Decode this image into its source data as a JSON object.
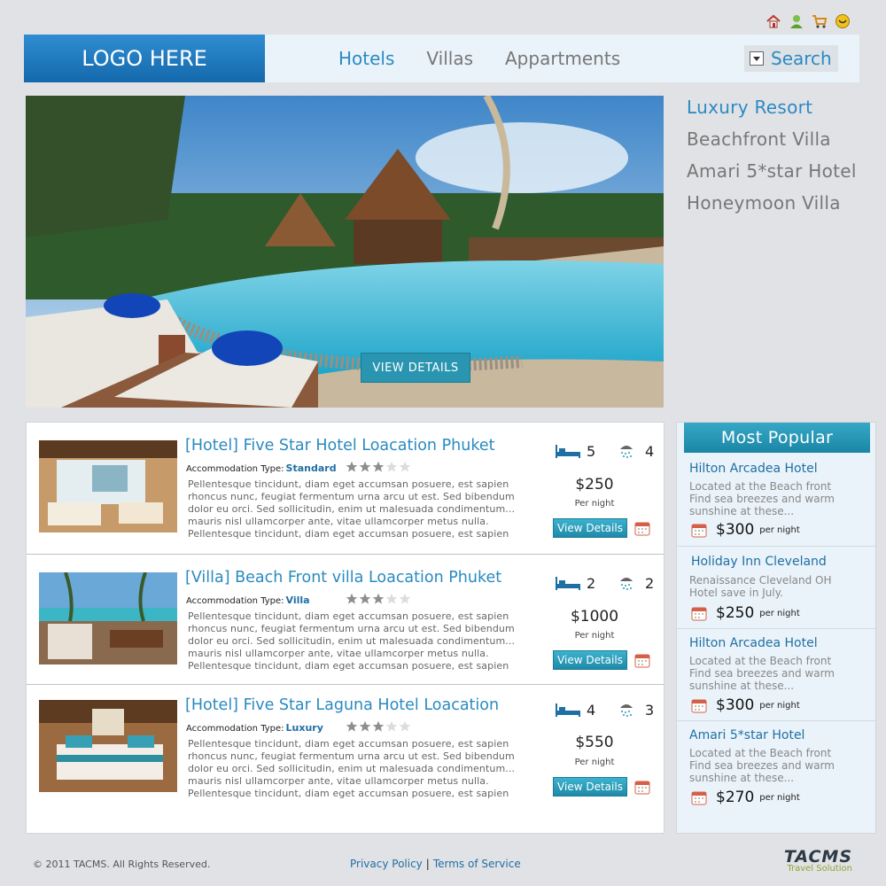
{
  "header": {
    "logo": "LOGO HERE",
    "nav": [
      {
        "label": "Hotels",
        "active": true
      },
      {
        "label": "Villas",
        "active": false
      },
      {
        "label": "Appartments",
        "active": false
      }
    ],
    "search_label": "Search"
  },
  "utility_icons": [
    "home-icon",
    "user-icon",
    "cart-icon",
    "help-icon"
  ],
  "hero": {
    "button_label": "VIEW DETAILS"
  },
  "side_nav": [
    {
      "label": "Luxury Resort",
      "active": true
    },
    {
      "label": "Beachfront Villa",
      "active": false
    },
    {
      "label": "Amari 5*star Hotel",
      "active": false
    },
    {
      "label": "Honeymoon Villa",
      "active": false
    }
  ],
  "listings": [
    {
      "title": "[Hotel] Five Star Hotel Loacation Phuket",
      "accommodation_label": "Accommodation Type:",
      "accommodation_type": "Standard",
      "rating": 3,
      "rating_max": 5,
      "description": [
        "Pellentesque tincidunt, diam eget accumsan posuere, est sapien",
        "rhoncus nunc, feugiat fermentum urna arcu ut est. Sed bibendum",
        "dolor eu orci. Sed sollicitudin, enim ut malesuada condimentum...",
        "mauris nisl ullamcorper ante, vitae ullamcorper metus nulla.",
        "Pellentesque tincidunt, diam eget accumsan posuere, est sapien"
      ],
      "beds": "5",
      "showers": "4",
      "price": "$250",
      "per_night": "Per night",
      "button_label": "View Details"
    },
    {
      "title": "[Villa] Beach Front villa Loacation Phuket",
      "accommodation_label": "Accommodation Type:",
      "accommodation_type": "Villa",
      "rating": 3,
      "rating_max": 5,
      "description": [
        "Pellentesque tincidunt, diam eget accumsan posuere, est sapien",
        "rhoncus nunc, feugiat fermentum urna arcu ut est. Sed bibendum",
        "dolor eu orci. Sed sollicitudin, enim ut malesuada condimentum...",
        "mauris nisl ullamcorper ante, vitae ullamcorper metus nulla.",
        "Pellentesque tincidunt, diam eget accumsan posuere, est sapien"
      ],
      "beds": "2",
      "showers": "2",
      "price": "$1000",
      "per_night": "Per night",
      "button_label": "View Details"
    },
    {
      "title": "[Hotel] Five Star Laguna Hotel Loacation",
      "accommodation_label": "Accommodation Type:",
      "accommodation_type": "Luxury",
      "rating": 3,
      "rating_max": 5,
      "description": [
        "Pellentesque tincidunt, diam eget accumsan posuere, est sapien",
        "rhoncus nunc, feugiat fermentum urna arcu ut est. Sed bibendum",
        "dolor eu orci. Sed sollicitudin, enim ut malesuada condimentum...",
        "mauris nisl ullamcorper ante, vitae ullamcorper metus nulla.",
        "Pellentesque tincidunt, diam eget accumsan posuere, est sapien"
      ],
      "beds": "4",
      "showers": "3",
      "price": "$550",
      "per_night": "Per night",
      "button_label": "View Details"
    }
  ],
  "popular": {
    "title": "Most Popular",
    "items": [
      {
        "name": "Hilton Arcadea Hotel",
        "description": [
          "Located at the Beach front",
          "Find sea breezes and warm",
          "sunshine at these..."
        ],
        "price": "$300",
        "per_night": "per night"
      },
      {
        "name": "Holiday Inn Cleveland",
        "description": [
          "Renaissance Cleveland OH",
          "Hotel save in July."
        ],
        "price": "$250",
        "per_night": "per night"
      },
      {
        "name": "Hilton Arcadea Hotel",
        "description": [
          "Located at the Beach front",
          "Find sea breezes and warm",
          "sunshine at these..."
        ],
        "price": "$300",
        "per_night": "per night"
      },
      {
        "name": "Amari 5*star Hotel",
        "description": [
          "Located at the Beach front",
          "Find sea breezes and warm",
          "sunshine at these..."
        ],
        "price": "$270",
        "per_night": "per night"
      }
    ]
  },
  "footer": {
    "copyright": "© 2011 TACMS. All Rights Reserved.",
    "privacy": "Privacy Policy",
    "separator": "|",
    "terms": "Terms of Service",
    "brand": "TACMS",
    "brand_sub": "Travel Solution"
  },
  "colors": {
    "accent": "#2b8ac3",
    "button": "#2a95b0",
    "background": "#e1e2e5"
  }
}
